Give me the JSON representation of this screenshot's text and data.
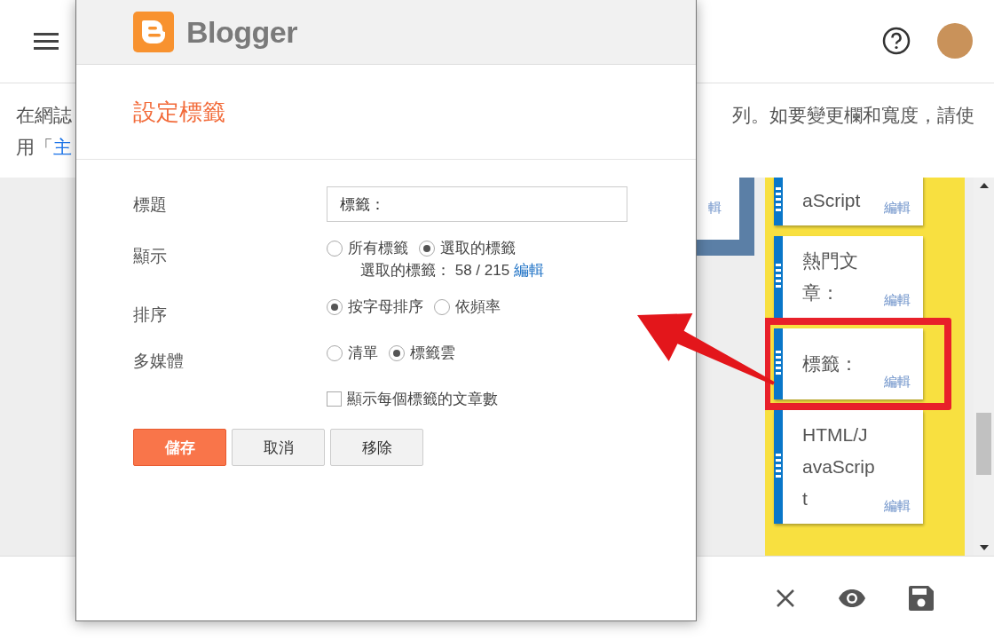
{
  "description": {
    "line1_start": "在網誌",
    "line1_end": "列。如要變更欄和寬度，請使",
    "line2_start": "用「",
    "line2_link": "主"
  },
  "background_panel": {
    "edit_link": "輯"
  },
  "widgets": [
    {
      "title": "aScript",
      "edit": "編輯",
      "highlighted": false
    },
    {
      "title": "熱門文章：",
      "edit": "編輯",
      "highlighted": false
    },
    {
      "title": "標籤：",
      "edit": "編輯",
      "highlighted": true
    },
    {
      "title": "HTML/JavaScript",
      "edit": "編輯",
      "highlighted": false
    }
  ],
  "dialog": {
    "logo_text": "Blogger",
    "title": "設定標籤",
    "fields": [
      {
        "kind": "text",
        "label": "標題",
        "value": "標籤："
      },
      {
        "kind": "radio",
        "label": "顯示",
        "options": [
          {
            "label": "所有標籤",
            "selected": false
          },
          {
            "label": "選取的標籤",
            "selected": true
          }
        ],
        "note": "選取的標籤： 58 / 215",
        "note_link": "編輯"
      },
      {
        "kind": "radio",
        "label": "排序",
        "options": [
          {
            "label": "按字母排序",
            "selected": true
          },
          {
            "label": "依頻率",
            "selected": false
          }
        ]
      },
      {
        "kind": "radio",
        "label": "多媒體",
        "options": [
          {
            "label": "清單",
            "selected": false
          },
          {
            "label": "標籤雲",
            "selected": true
          }
        ]
      },
      {
        "kind": "checkbox",
        "label": "顯示每個標籤的文章數",
        "checked": false
      }
    ],
    "buttons": [
      {
        "label": "儲存",
        "kind": "primary"
      },
      {
        "label": "取消",
        "kind": "secondary"
      },
      {
        "label": "移除",
        "kind": "secondary"
      }
    ]
  }
}
